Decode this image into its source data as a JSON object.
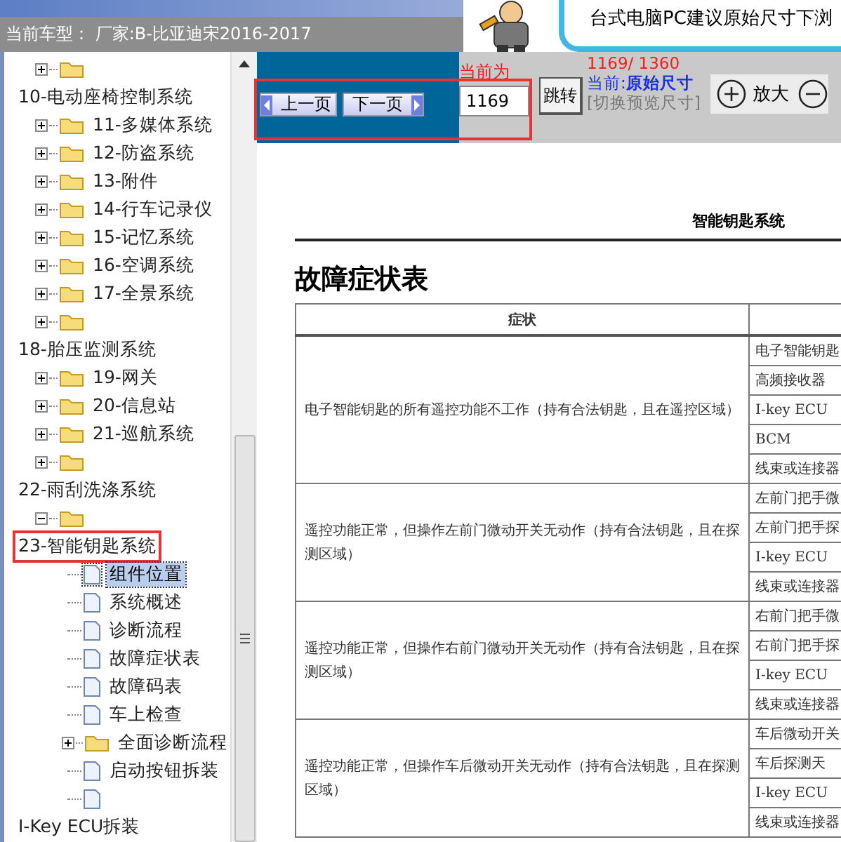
{
  "header": {
    "car_model": "当前车型： 厂家:B-比亚迪宋2016-2017",
    "banner_text": "台式电脑PC建议原始尺寸下浏"
  },
  "tree": [
    {
      "kind": "group",
      "children": [
        {
          "kind": "folder",
          "expanded": false
        }
      ]
    },
    {
      "kind": "heading",
      "label": "10-电动座椅控制系统",
      "annotated": false,
      "children": [
        {
          "kind": "folder",
          "expanded": false,
          "label": "11-多媒体系统"
        },
        {
          "kind": "folder",
          "expanded": false,
          "label": "12-防盗系统"
        },
        {
          "kind": "folder",
          "expanded": false,
          "label": "13-附件"
        },
        {
          "kind": "folder",
          "expanded": false,
          "label": "14-行车记录仪"
        },
        {
          "kind": "folder",
          "expanded": false,
          "label": "15-记忆系统"
        },
        {
          "kind": "folder",
          "expanded": false,
          "label": "16-空调系统"
        },
        {
          "kind": "folder",
          "expanded": false,
          "label": "17-全景系统"
        },
        {
          "kind": "folder",
          "expanded": false
        }
      ]
    },
    {
      "kind": "heading",
      "label": "18-胎压监测系统",
      "annotated": false,
      "children": [
        {
          "kind": "folder",
          "expanded": false,
          "label": "19-网关"
        },
        {
          "kind": "folder",
          "expanded": false,
          "label": "20-信息站"
        },
        {
          "kind": "folder",
          "expanded": false,
          "label": "21-巡航系统"
        },
        {
          "kind": "folder",
          "expanded": false
        }
      ]
    },
    {
      "kind": "heading",
      "label": "22-雨刮洗涤系统",
      "annotated": false,
      "children": [
        {
          "kind": "folder",
          "expanded": true
        }
      ]
    },
    {
      "kind": "heading",
      "label": "23-智能钥匙系统",
      "annotated": true,
      "children": [
        {
          "kind": "group",
          "children": [
            {
              "kind": "page",
              "label": "组件位置",
              "selected": true
            },
            {
              "kind": "page",
              "label": "系统概述",
              "selected": false
            },
            {
              "kind": "page",
              "label": "诊断流程",
              "selected": false
            },
            {
              "kind": "page",
              "label": "故障症状表",
              "selected": false
            },
            {
              "kind": "page",
              "label": "故障码表",
              "selected": false
            },
            {
              "kind": "page",
              "label": "车上检查",
              "selected": false
            },
            {
              "kind": "folder",
              "expanded": false,
              "label": "全面诊断流程"
            },
            {
              "kind": "page",
              "label": "启动按钮拆装",
              "selected": false
            },
            {
              "kind": "page",
              "selected": false
            }
          ]
        }
      ]
    },
    {
      "kind": "heading",
      "label": "I-Key ECU拆装",
      "annotated": false
    }
  ],
  "toolbar": {
    "annotated": true,
    "prev": "上一页",
    "next": "下一页",
    "current_label": "当前为",
    "page_input": "1169",
    "jump": "跳转",
    "page_count": "1169/ 1360",
    "mode_label": "当前:",
    "mode": "原始尺寸",
    "toggle": "[切换预览尺寸]",
    "zoom_in": "放大"
  },
  "document": {
    "running_head": "智能钥匙系统",
    "title": "故障症状表",
    "columns": [
      "症状"
    ],
    "rows": [
      {
        "symptom": "电子智能钥匙的所有遥控功能不工作（持有合法钥匙，且在遥控区域）",
        "parts": [
          "电子智能钥匙",
          "高频接收器",
          "I-key ECU",
          "BCM",
          "线束或连接器"
        ]
      },
      {
        "symptom": "遥控功能正常，但操作左前门微动开关无动作（持有合法钥匙，且在探测区域）",
        "parts": [
          "左前门把手微",
          "左前门把手探",
          "I-key ECU",
          "线束或连接器"
        ]
      },
      {
        "symptom": "遥控功能正常，但操作右前门微动开关无动作（持有合法钥匙，且在探测区域）",
        "parts": [
          "右前门把手微",
          "右前门把手探",
          "I-key ECU",
          "线束或连接器"
        ]
      },
      {
        "symptom": "遥控功能正常，但操作车后微动开关无动作（持有合法钥匙，且在探测区域）",
        "parts": [
          "车后微动开关",
          "车后探测天",
          "I-key ECU",
          "线束或连接器"
        ]
      }
    ]
  }
}
